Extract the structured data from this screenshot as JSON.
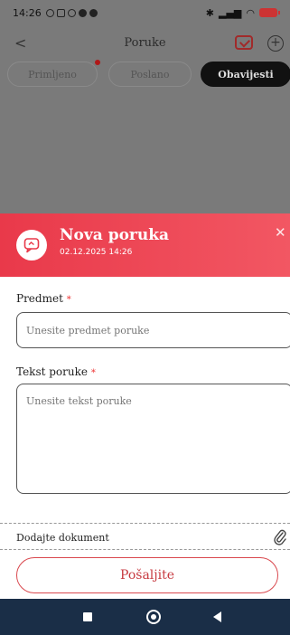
{
  "status_bar": {
    "time": "14:26"
  },
  "header": {
    "title": "Poruke"
  },
  "tabs": [
    {
      "label": "Primljeno",
      "has_notification": true
    },
    {
      "label": "Poslano"
    },
    {
      "label": "Obavijesti",
      "selected": true
    }
  ],
  "modal": {
    "title": "Nova poruka",
    "date": "02.12.2025 14:26",
    "subject_label": "Predmet",
    "subject_placeholder": "Unesite predmet poruke",
    "body_label": "Tekst poruke",
    "body_placeholder": "Unesite tekst poruke",
    "required_mark": "*",
    "attach_label": "Dodajte dokument",
    "send_label": "Pošaljite"
  },
  "colors": {
    "accent": "#e9394a",
    "nav_bar": "#1a2e47"
  }
}
